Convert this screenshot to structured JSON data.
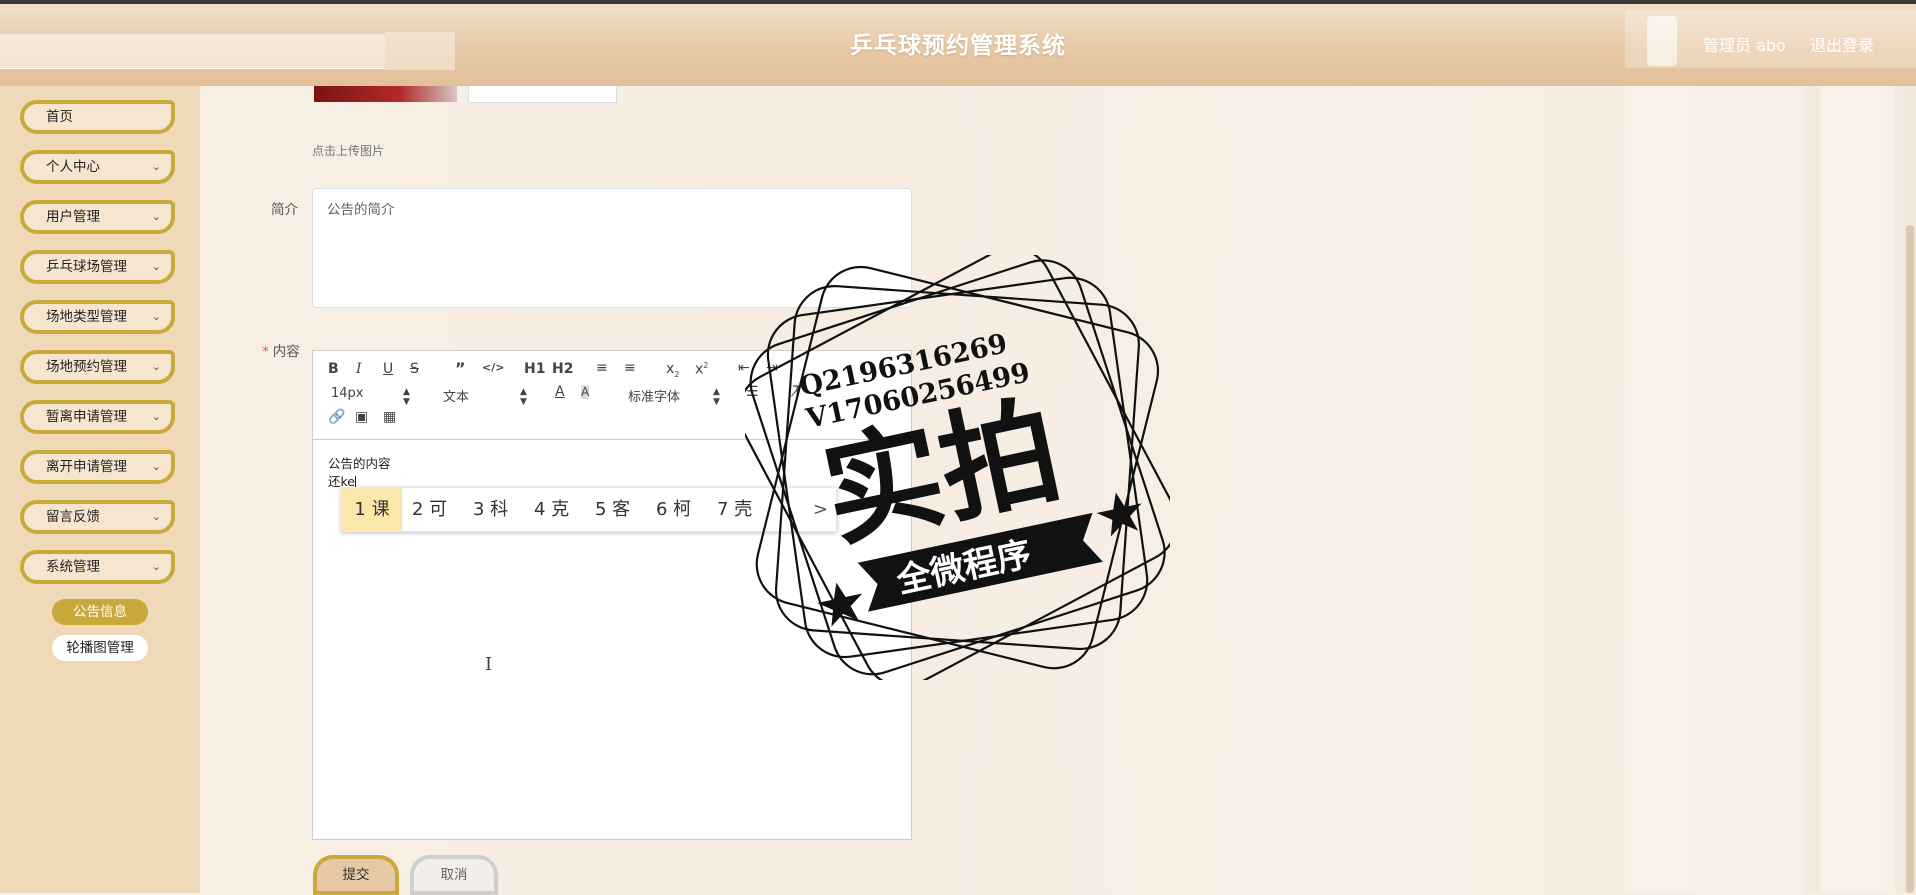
{
  "header": {
    "title": "乒乓球预约管理系统",
    "user_label": "管理员 abo",
    "logout_label": "退出登录"
  },
  "sidebar": {
    "items": [
      {
        "label": "首页",
        "has_arrow": false
      },
      {
        "label": "个人中心",
        "has_arrow": true
      },
      {
        "label": "用户管理",
        "has_arrow": true
      },
      {
        "label": "乒乓球场管理",
        "has_arrow": true
      },
      {
        "label": "场地类型管理",
        "has_arrow": true
      },
      {
        "label": "场地预约管理",
        "has_arrow": true
      },
      {
        "label": "暂离申请管理",
        "has_arrow": true
      },
      {
        "label": "离开申请管理",
        "has_arrow": true
      },
      {
        "label": "留言反馈",
        "has_arrow": true
      },
      {
        "label": "系统管理",
        "has_arrow": true
      }
    ],
    "sub_items": [
      {
        "label": "公告信息",
        "active": true
      },
      {
        "label": "轮播图管理",
        "active": false
      }
    ]
  },
  "form": {
    "upload_tip": "点击上传图片",
    "intro_label": "简介",
    "intro_value": "公告的简介",
    "content_label": "内容",
    "content_required": "*",
    "content_lines": [
      "公告的内容",
      "还ke"
    ],
    "submit_label": "提交",
    "cancel_label": "取消"
  },
  "toolbar": {
    "font_size": "14px",
    "block_type": "文本",
    "font_family": "标准字体",
    "h1": "H1",
    "h2": "H2"
  },
  "ime": {
    "candidates": [
      "1 课",
      "2 可",
      "3 科",
      "4 克",
      "5 客",
      "6 柯",
      "7 壳"
    ],
    "selected_index": 0,
    "next_symbol": ">"
  },
  "watermark": {
    "line1": "Q2196316269",
    "line2": "V17060256499",
    "main": "实拍",
    "banner": "全微程序"
  },
  "icons": {
    "chevron": "chevron-down-icon",
    "text_cursor": "text-cursor-icon"
  },
  "colors": {
    "accent": "#c9a93a",
    "header": "#e7c8a5",
    "sidebar": "#f0d9b9"
  }
}
